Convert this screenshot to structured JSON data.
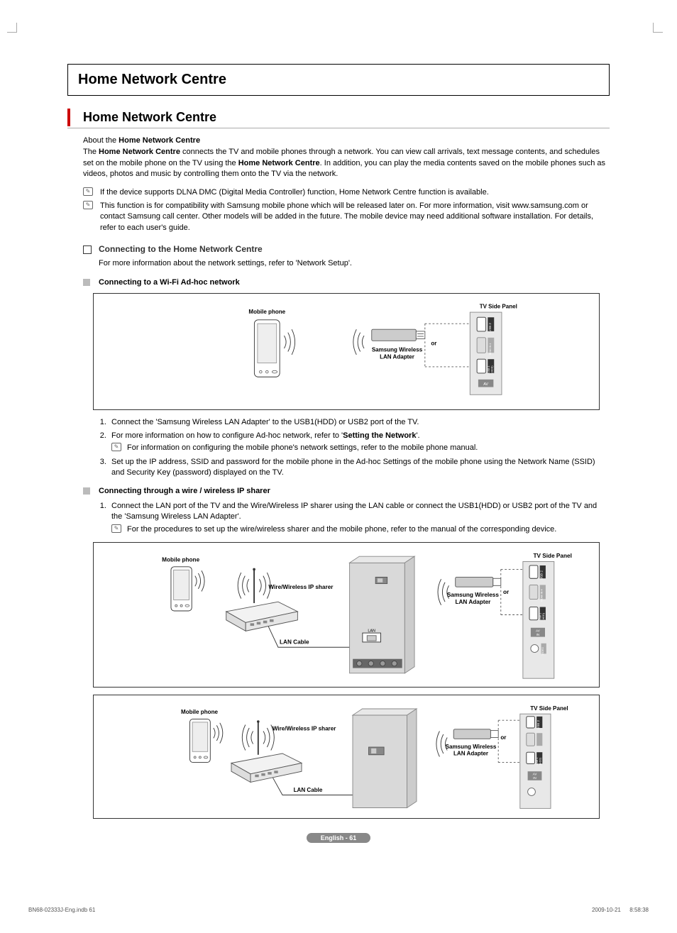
{
  "title_box": "Home Network Centre",
  "section_title": "Home Network Centre",
  "about": {
    "heading_prefix": "About the ",
    "heading_bold": "Home Network Centre",
    "para_a": "The ",
    "para_b": "Home Network Centre",
    "para_c": " connects the TV and mobile phones through a network. You can view call arrivals, text message contents, and schedules set on the mobile phone on the TV using the ",
    "para_d": "Home Network Centre",
    "para_e": ". In addition, you can play the media contents saved on the mobile phones such as videos, photos and music by controlling them onto the TV via the network."
  },
  "notes": [
    "If the device supports DLNA DMC (Digital Media Controller) function, Home Network Centre function is available.",
    "This function is for compatibility with Samsung mobile phone which will be released later on. For more information, visit www.samsung.com or contact Samsung call center. Other models will be added in the future. The mobile device may need additional software installation. For details, refer to each user's guide."
  ],
  "sub1": {
    "title": "Connecting to the Home Network Centre",
    "desc": "For more information about the network settings, refer to 'Network Setup'."
  },
  "adhoc": {
    "title": "Connecting to a Wi-Fi Ad-hoc network",
    "labels": {
      "mobile": "Mobile phone",
      "tvpanel": "TV Side Panel",
      "adapter1": "Samsung Wireless",
      "adapter2": "LAN Adapter",
      "or": "or",
      "usb2": "USB 2",
      "hdmi": "HDMI IN 4",
      "usb1a": "USB 1",
      "usb1b": "(HDD)",
      "av": "AV"
    },
    "steps": {
      "s1": "Connect the 'Samsung Wireless LAN Adapter' to the USB1(HDD) or USB2 port of the TV.",
      "s2_a": "For more information on how to configure Ad-hoc network, refer to '",
      "s2_b": "Setting the Network",
      "s2_c": "'.",
      "s2_note": "For information on configuring the mobile phone's network settings, refer to the mobile phone manual.",
      "s3": "Set up the IP address, SSID and password for the mobile phone in the Ad-hoc Settings of the mobile phone using the Network Name (SSID) and Security Key (password) displayed on the TV."
    }
  },
  "ipsharer": {
    "title": "Connecting through a wire / wireless IP sharer",
    "steps": {
      "s1": "Connect the LAN port of the TV and the Wire/Wireless IP sharer using the LAN cable or connect the USB1(HDD) or USB2 port of the TV and the 'Samsung Wireless LAN Adapter'.",
      "s1_note": "For the procedures to set up the wire/wireless sharer and the mobile phone, refer to the manual of the corresponding device."
    },
    "labels": {
      "mobile": "Mobile phone",
      "router": "Wire/Wireless IP sharer",
      "lan": "LAN Cable",
      "lanport": "LAN",
      "tvpanel": "TV Side Panel",
      "adapter1": "Samsung Wireless",
      "adapter2": "LAN Adapter",
      "or": "or",
      "avin": "AV\nIN",
      "video": "VIDEO"
    }
  },
  "pagebar": "English - 61",
  "footer_left": "BN68-02333J-Eng.indb   61",
  "footer_right": "2009-10-21     8:58:38"
}
